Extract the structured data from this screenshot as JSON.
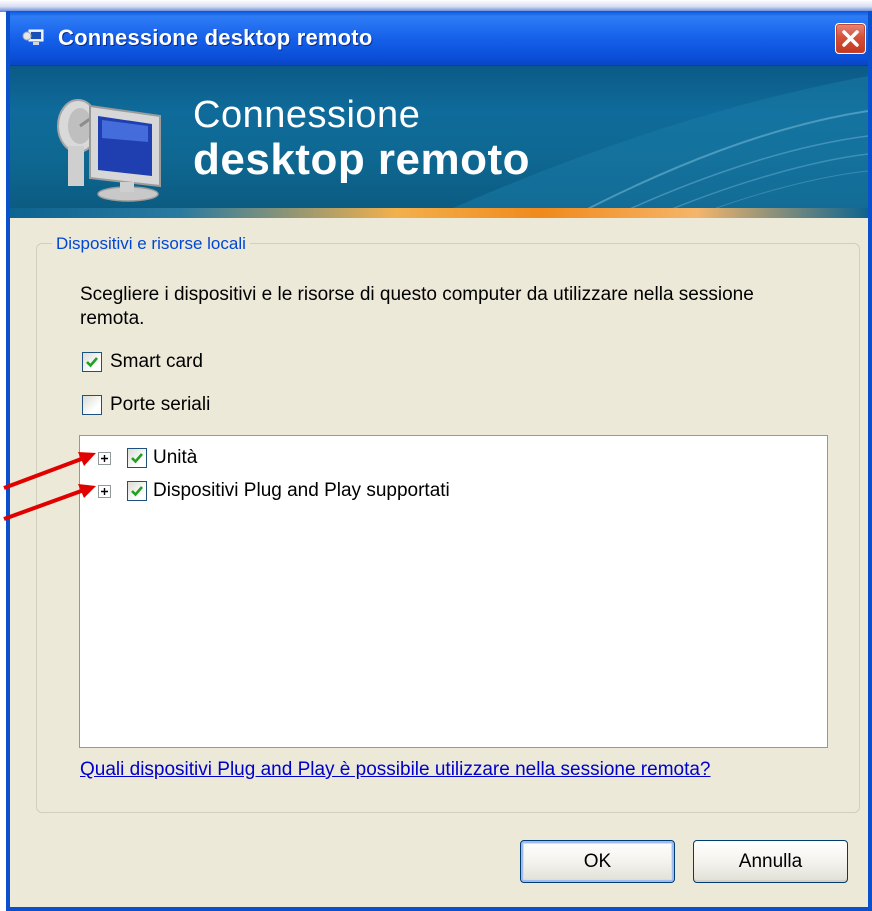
{
  "window": {
    "title": "Connessione desktop remoto"
  },
  "banner": {
    "line1": "Connessione",
    "line2": "desktop remoto"
  },
  "group": {
    "legend": "Dispositivi e risorse locali",
    "description": "Scegliere i dispositivi e le risorse di questo computer da utilizzare nella sessione remota."
  },
  "options": {
    "smart_card": {
      "label": "Smart card",
      "checked": true
    },
    "serial_ports": {
      "label": "Porte seriali",
      "checked": false
    }
  },
  "tree": {
    "items": [
      {
        "label": "Unità",
        "checked": true,
        "expander": "+"
      },
      {
        "label": "Dispositivi Plug and Play supportati",
        "checked": true,
        "expander": "+"
      }
    ]
  },
  "help_link": "Quali dispositivi Plug and Play è possibile utilizzare nella sessione remota?",
  "buttons": {
    "ok": "OK",
    "cancel": "Annulla"
  },
  "colors": {
    "titlebar": "#1661ea",
    "banner": "#0e6892",
    "dialog_background": "#ece9d8",
    "legend_text": "#0046d5",
    "link": "#0000cc",
    "checkmark": "#21a121",
    "annotation_arrow": "#e00000"
  },
  "icons": {
    "title": "remote-desktop-icon",
    "banner": "computer-with-satellite-dish-icon",
    "close": "close-icon",
    "check": "checkmark-icon",
    "expander": "plus-icon",
    "annotation": "red-arrow-icon"
  }
}
